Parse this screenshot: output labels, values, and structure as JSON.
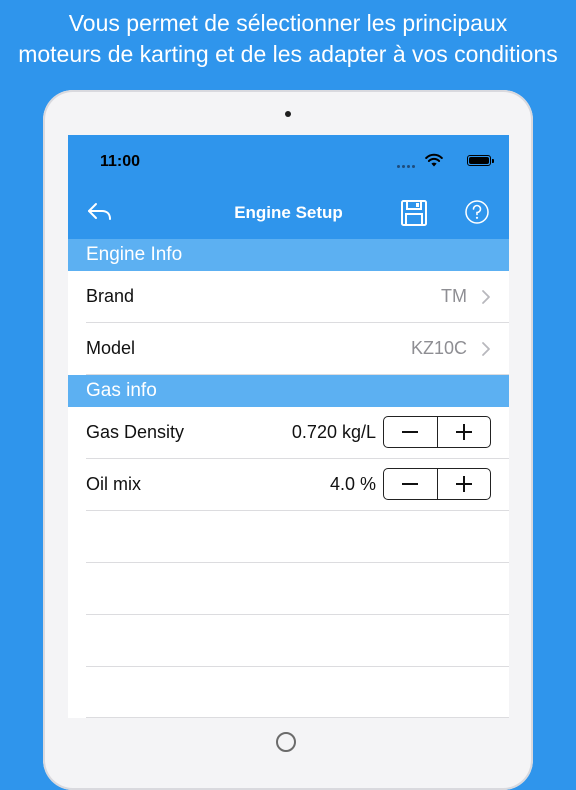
{
  "promo": {
    "line1": "Vous permet de sélectionner les principaux",
    "line2": "moteurs de karting et de les adapter à vos conditions"
  },
  "status_bar": {
    "time": "11:00"
  },
  "nav": {
    "title": "Engine Setup",
    "back_icon": "undo-arrow-icon",
    "save_icon": "floppy-disk-icon",
    "help_icon": "question-circle-icon"
  },
  "sections": {
    "engine_info": {
      "header": "Engine Info",
      "rows": [
        {
          "label": "Brand",
          "value": "TM"
        },
        {
          "label": "Model",
          "value": "KZ10C"
        }
      ]
    },
    "gas_info": {
      "header": "Gas info",
      "rows": [
        {
          "label": "Gas Density",
          "value": "0.720 kg/L"
        },
        {
          "label": "Oil mix",
          "value": "4.0 %"
        }
      ]
    }
  },
  "colors": {
    "primary_blue": "#2f95ec",
    "section_blue": "#5cb0f2",
    "secondary_text": "#8e8e93"
  }
}
